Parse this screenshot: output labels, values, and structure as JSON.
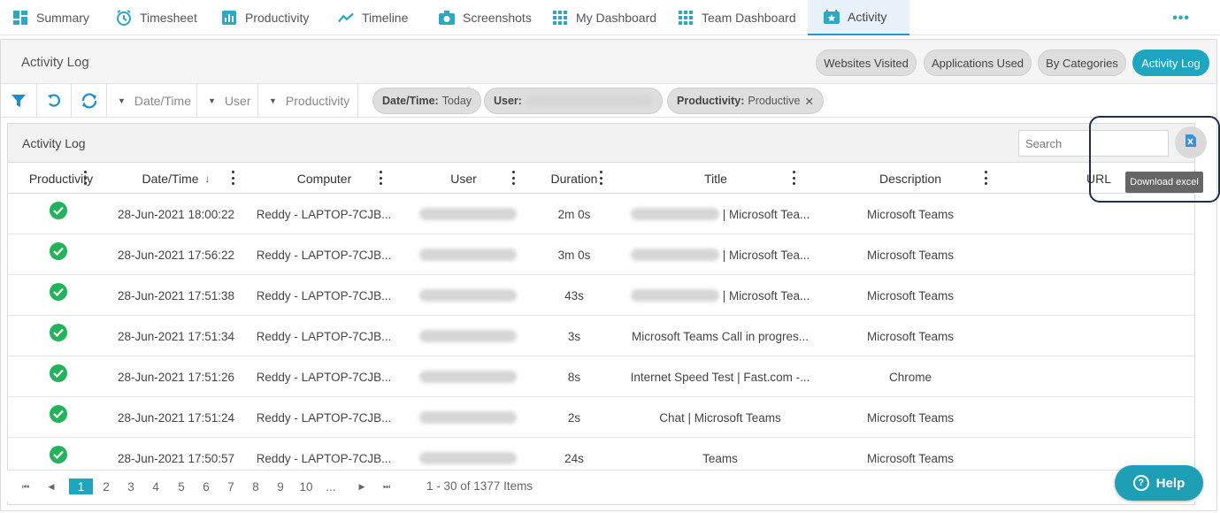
{
  "nav": {
    "tabs": [
      {
        "label": "Summary",
        "icon": "grid-squares-icon"
      },
      {
        "label": "Timesheet",
        "icon": "clock-icon"
      },
      {
        "label": "Productivity",
        "icon": "bar-chart-icon"
      },
      {
        "label": "Timeline",
        "icon": "trend-line-icon"
      },
      {
        "label": "Screenshots",
        "icon": "camera-icon"
      },
      {
        "label": "My Dashboard",
        "icon": "dashboard-icon"
      },
      {
        "label": "Team Dashboard",
        "icon": "dashboard-icon"
      },
      {
        "label": "Activity",
        "icon": "star-calendar-icon"
      }
    ],
    "active_tab": "Activity",
    "more": "•••"
  },
  "header": {
    "title": "Activity Log",
    "views": [
      {
        "label": "Websites Visited"
      },
      {
        "label": "Applications Used"
      },
      {
        "label": "By Categories"
      },
      {
        "label": "Activity Log"
      }
    ],
    "active_view": "Activity Log"
  },
  "filters": {
    "dropdowns": [
      {
        "label": "Date/Time"
      },
      {
        "label": "User"
      },
      {
        "label": "Productivity"
      }
    ],
    "chips": [
      {
        "key": "Date/Time:",
        "value": "Today"
      },
      {
        "key": "User:",
        "value": ""
      },
      {
        "key": "Productivity:",
        "value": "Productive",
        "remove": "✕"
      }
    ]
  },
  "grid": {
    "title": "Activity Log",
    "search_placeholder": "Search",
    "columns": [
      {
        "label": "Productivity"
      },
      {
        "label": "Date/Time",
        "sort": "↓"
      },
      {
        "label": "Computer"
      },
      {
        "label": "User"
      },
      {
        "label": "Duration"
      },
      {
        "label": "Title"
      },
      {
        "label": "Description"
      },
      {
        "label": "URL"
      }
    ],
    "rows": [
      {
        "datetime": "28-Jun-2021 18:00:22",
        "computer": "Reddy - LAPTOP-7CJB...",
        "duration": "2m 0s",
        "title": "| Microsoft Tea...",
        "title_blurred": true,
        "description": "Microsoft Teams"
      },
      {
        "datetime": "28-Jun-2021 17:56:22",
        "computer": "Reddy - LAPTOP-7CJB...",
        "duration": "3m 0s",
        "title": "| Microsoft Tea...",
        "title_blurred": true,
        "description": "Microsoft Teams"
      },
      {
        "datetime": "28-Jun-2021 17:51:38",
        "computer": "Reddy - LAPTOP-7CJB...",
        "duration": "43s",
        "title": "| Microsoft Tea...",
        "title_blurred": true,
        "description": "Microsoft Teams"
      },
      {
        "datetime": "28-Jun-2021 17:51:34",
        "computer": "Reddy - LAPTOP-7CJB...",
        "duration": "3s",
        "title": "Microsoft Teams Call in progres...",
        "title_blurred": false,
        "description": "Microsoft Teams"
      },
      {
        "datetime": "28-Jun-2021 17:51:26",
        "computer": "Reddy - LAPTOP-7CJB...",
        "duration": "8s",
        "title": "Internet Speed Test | Fast.com -...",
        "title_blurred": false,
        "description": "Chrome"
      },
      {
        "datetime": "28-Jun-2021 17:51:24",
        "computer": "Reddy - LAPTOP-7CJB...",
        "duration": "2s",
        "title": "Chat | Microsoft Teams",
        "title_blurred": false,
        "description": "Microsoft Teams"
      },
      {
        "datetime": "28-Jun-2021 17:50:57",
        "computer": "Reddy - LAPTOP-7CJB...",
        "duration": "24s",
        "title": "Teams",
        "title_blurred": false,
        "description": "Microsoft Teams"
      }
    ],
    "tooltip": "Download excel"
  },
  "pager": {
    "first": "⏮",
    "prev": "◀",
    "next": "▶",
    "last": "⏭",
    "pages": [
      "1",
      "2",
      "3",
      "4",
      "5",
      "6",
      "7",
      "8",
      "9",
      "10",
      "..."
    ],
    "current_page": "1",
    "info": "1 - 30 of 1377 Items"
  },
  "help": {
    "label": "Help"
  },
  "colors": {
    "accent": "#1ea6c0",
    "productive": "#23b35a",
    "highlight_border": "#1f2e4d"
  }
}
